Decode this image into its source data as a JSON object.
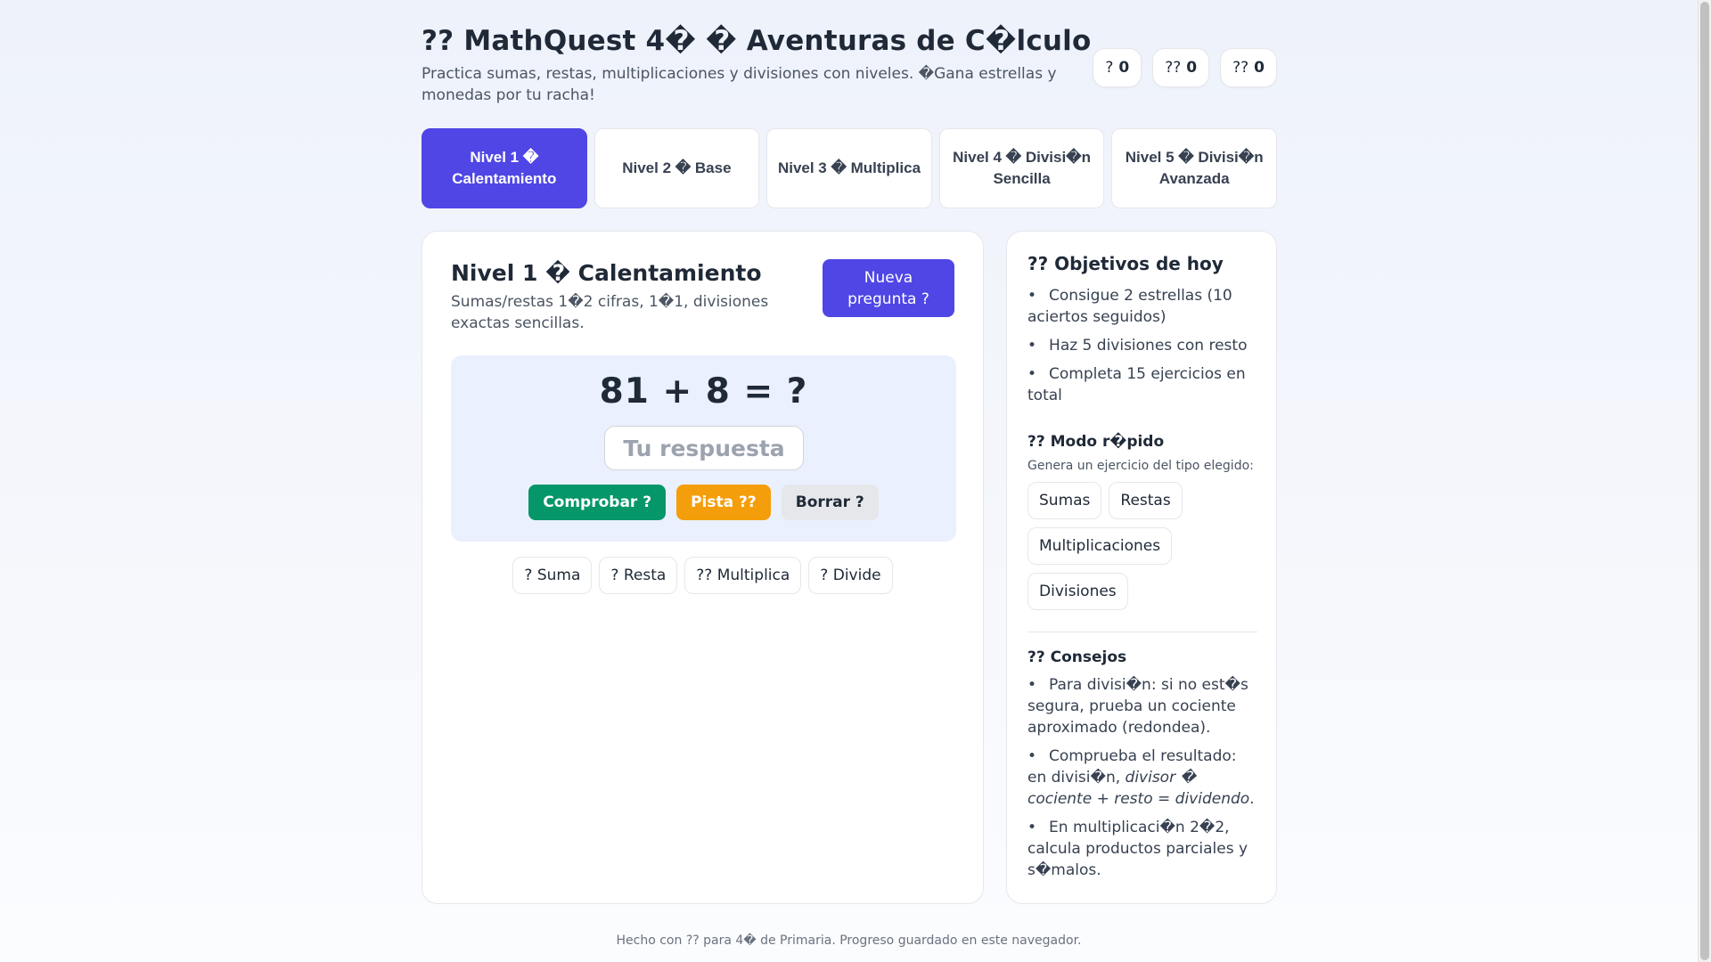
{
  "header": {
    "title": "?? MathQuest 4� � Aventuras de C�lculo",
    "subtitle": "Practica sumas, restas, multiplicaciones y divisiones con niveles. �Gana estrellas y monedas por tu racha!",
    "stats": [
      {
        "icon": "?",
        "value": "0"
      },
      {
        "icon": "??",
        "value": "0"
      },
      {
        "icon": "??",
        "value": "0"
      }
    ]
  },
  "levels": [
    {
      "label": "Nivel 1 � Calentamiento",
      "active": true
    },
    {
      "label": "Nivel 2 � Base",
      "active": false
    },
    {
      "label": "Nivel 3 � Multiplica",
      "active": false
    },
    {
      "label": "Nivel 4 � Divisi�n Sencilla",
      "active": false
    },
    {
      "label": "Nivel 5 � Divisi�n Avanzada",
      "active": false
    }
  ],
  "main": {
    "level_title": "Nivel 1 � Calentamiento",
    "level_desc": "Sumas/restas 1�2 cifras, 1�1, divisiones exactas sencillas.",
    "new_question_label": "Nueva pregunta ?",
    "question": "81 + 8 = ?",
    "answer_placeholder": "Tu respuesta",
    "answer_value": "",
    "check_label": "Comprobar ?",
    "hint_label": "Pista ??",
    "clear_label": "Borrar ?",
    "ops": [
      "? Suma",
      "? Resta",
      "?? Multiplica",
      "? Divide"
    ]
  },
  "side": {
    "goals_title": "?? Objetivos de hoy",
    "goals": [
      "Consigue 2 estrellas (10 aciertos seguidos)",
      "Haz 5 divisiones con resto",
      "Completa 15 ejercicios en total"
    ],
    "quick_title": "?? Modo r�pido",
    "quick_desc": "Genera un ejercicio del tipo elegido:",
    "quick_options": [
      "Sumas",
      "Restas",
      "Multiplicaciones",
      "Divisiones"
    ],
    "tips_title": "?? Consejos",
    "tip1": "Para divisi�n: si no est�s segura, prueba un cociente aproximado (redondea).",
    "tip2_prefix": "Comprueba el resultado: en divisi�n, ",
    "tip2_em": "divisor � cociente + resto = dividendo",
    "tip2_suffix": ".",
    "tip3": "En multiplicaci�n 2�2, calcula productos parciales y s�malos."
  },
  "footer": "Hecho con ?? para 4� de Primaria. Progreso guardado en este navegador.",
  "colors": {
    "accent": "#4f46e5",
    "success": "#059669",
    "warning": "#f59e0b",
    "neutral": "#e5e7eb"
  }
}
